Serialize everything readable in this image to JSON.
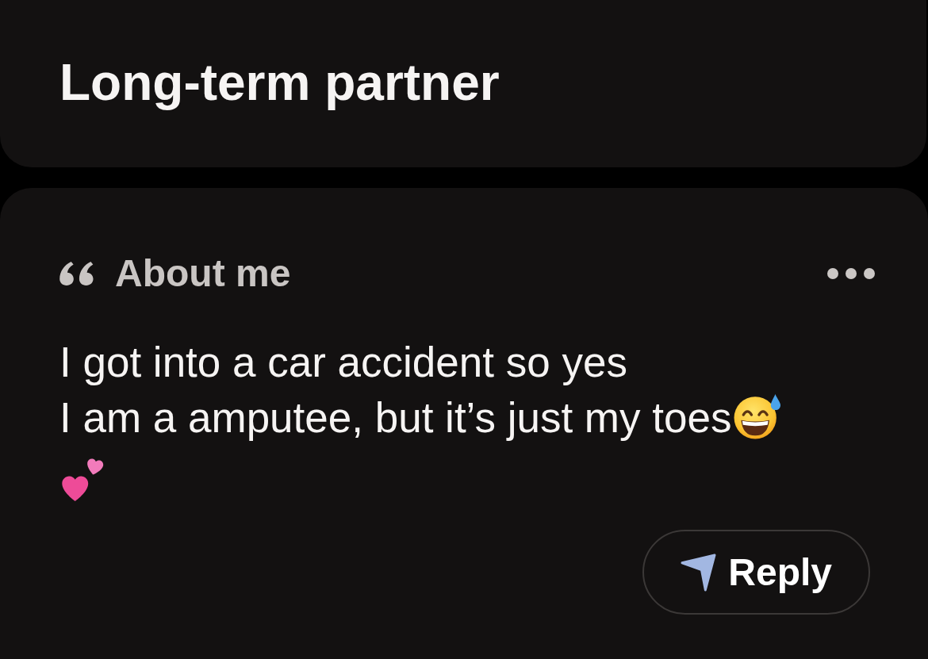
{
  "looking_for": {
    "value": "Long-term partner"
  },
  "about_me": {
    "title": "About me",
    "lines": [
      "I got into a car accident so yes",
      "I am a amputee, but it’s just my toes"
    ]
  },
  "reply_button": {
    "label": "Reply"
  }
}
